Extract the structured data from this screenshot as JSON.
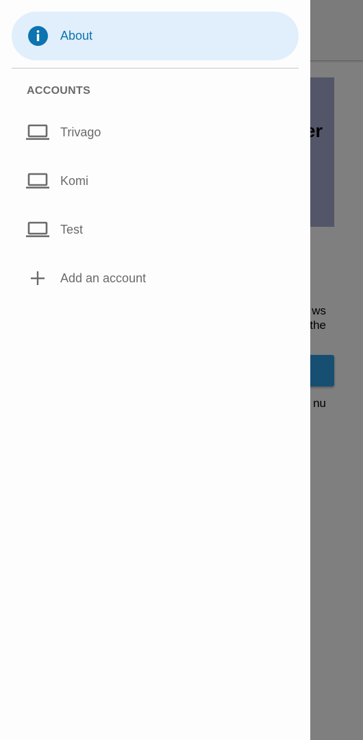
{
  "drawer": {
    "about": {
      "label": "About",
      "icon": "info-icon",
      "color": "#0c74b0"
    },
    "accounts_header": "ACCOUNTS",
    "accounts": [
      {
        "label": "Trivago",
        "icon": "laptop-icon"
      },
      {
        "label": "Komi",
        "icon": "laptop-icon"
      },
      {
        "label": "Test",
        "icon": "laptop-icon"
      }
    ],
    "add_account": {
      "label": "Add an account",
      "icon": "plus-icon"
    }
  },
  "background": {
    "card_text_fragment": "er",
    "text_fragment_1": "ws",
    "text_fragment_2": "the",
    "text_fragment_3": "nu"
  },
  "colors": {
    "accent": "#0c74b0",
    "selected_bg": "#e1eefc",
    "text_secondary": "#6a6a6a"
  }
}
